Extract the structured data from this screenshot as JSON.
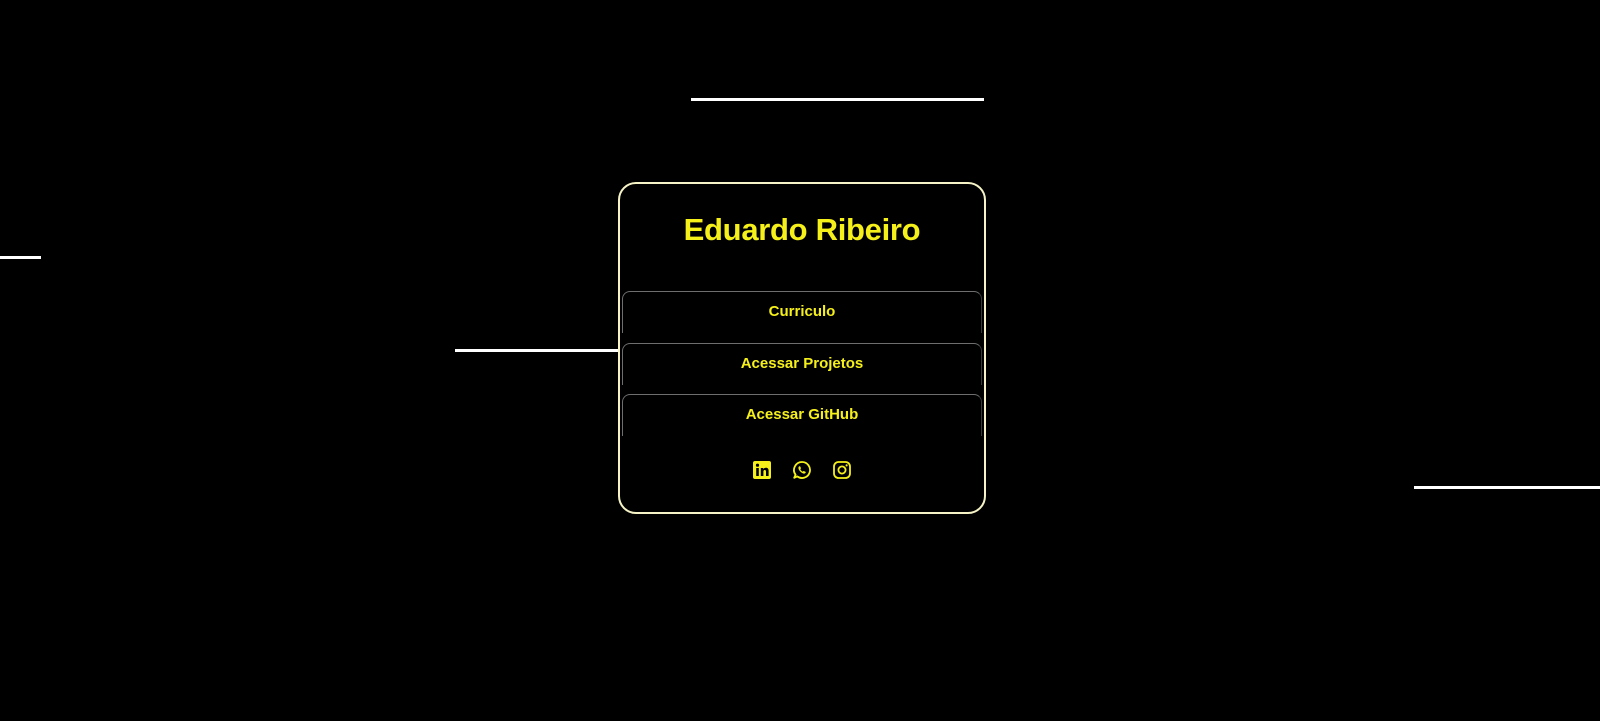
{
  "profile": {
    "name": "Eduardo Ribeiro"
  },
  "links": [
    {
      "label": "Curriculo"
    },
    {
      "label": "Acessar Projetos"
    },
    {
      "label": "Acessar GitHub"
    }
  ],
  "socials": [
    {
      "icon": "linkedin-icon"
    },
    {
      "icon": "whatsapp-icon"
    },
    {
      "icon": "instagram-icon"
    }
  ],
  "colors": {
    "background": "#000000",
    "accent": "#f5ef1a",
    "card_border": "#f6f4c6",
    "decor_lines": "#ffffff"
  }
}
